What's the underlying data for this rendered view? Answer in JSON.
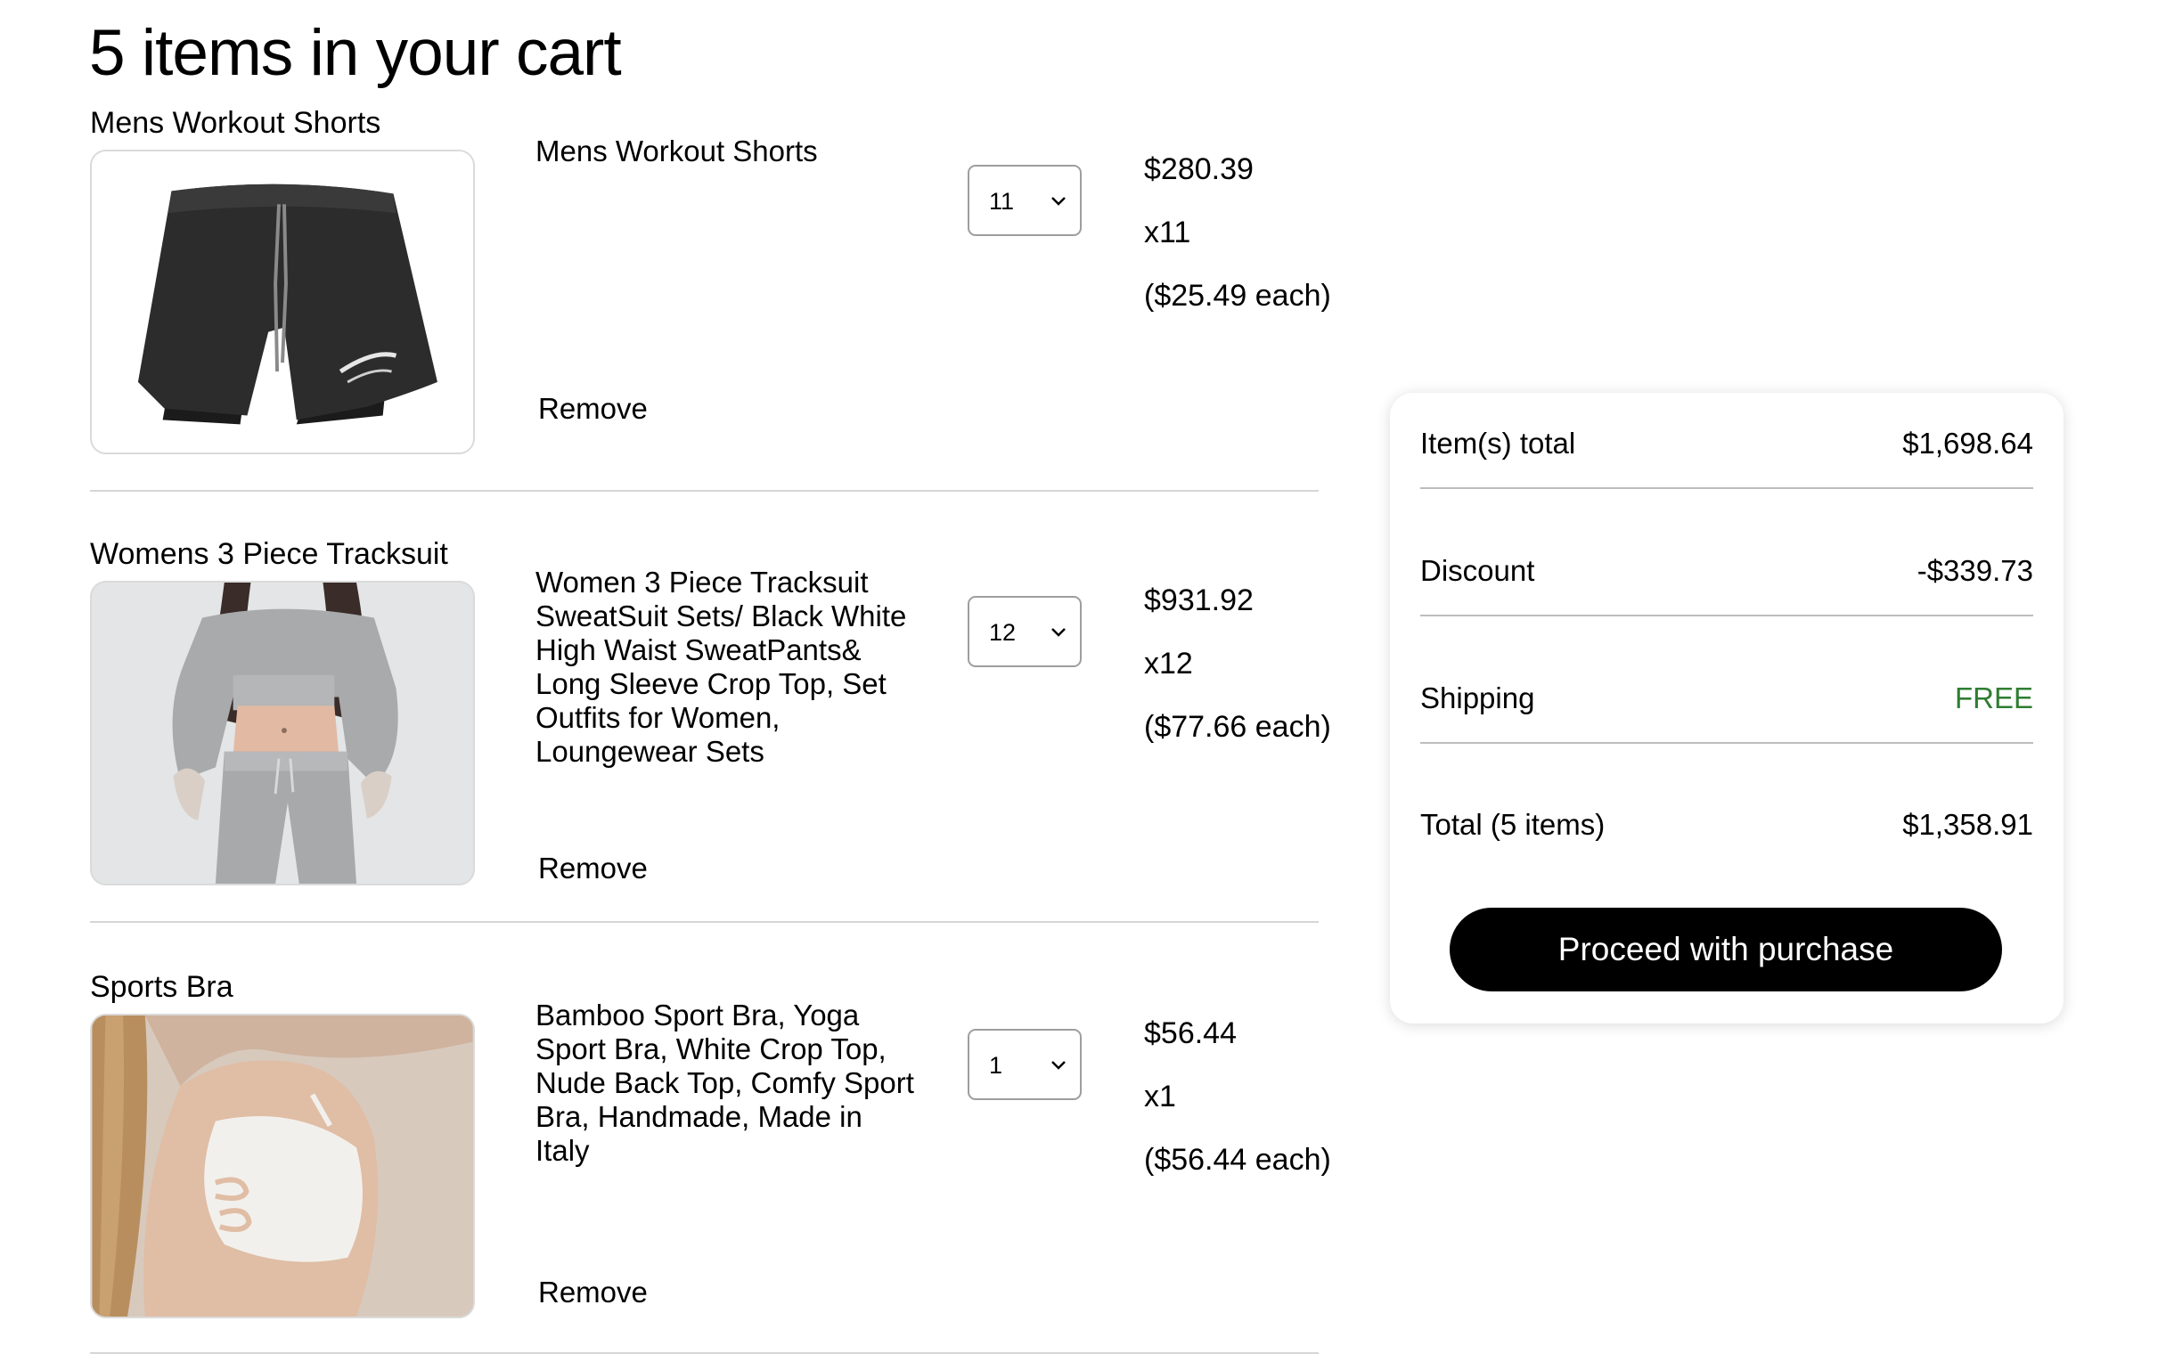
{
  "page": {
    "title": "5 items in your cart"
  },
  "items": [
    {
      "heading": "Mens Workout Shorts",
      "name": "Mens Workout Shorts",
      "quantity": "11",
      "total_price": "$280.39",
      "quantity_label": "x11",
      "unit_price": "($25.49 each)",
      "remove_label": "Remove"
    },
    {
      "heading": "Womens 3 Piece Tracksuit",
      "name": "Women 3 Piece Tracksuit SweatSuit Sets/ Black White High Waist SweatPants& Long Sleeve Crop Top, Set Outfits for Women, Loungewear Sets",
      "quantity": "12",
      "total_price": "$931.92",
      "quantity_label": "x12",
      "unit_price": "($77.66 each)",
      "remove_label": "Remove"
    },
    {
      "heading": "Sports Bra",
      "name": "Bamboo Sport Bra, Yoga Sport Bra, White Crop Top, Nude Back Top, Comfy Sport Bra, Handmade, Made in Italy",
      "quantity": "1",
      "total_price": "$56.44",
      "quantity_label": "x1",
      "unit_price": "($56.44 each)",
      "remove_label": "Remove"
    }
  ],
  "summary": {
    "items_total_label": "Item(s) total",
    "items_total_value": "$1,698.64",
    "discount_label": "Discount",
    "discount_value": "-$339.73",
    "shipping_label": "Shipping",
    "shipping_value": "FREE",
    "total_label": "Total (5 items)",
    "total_value": "$1,358.91",
    "purchase_button_label": "Proceed with purchase"
  },
  "colors": {
    "free_shipping": "#2f7d32",
    "button_background": "#000000",
    "button_text": "#ffffff",
    "divider": "#d6d6d6"
  },
  "icons": {
    "quantity_dropdown": "chevron-down-icon"
  }
}
